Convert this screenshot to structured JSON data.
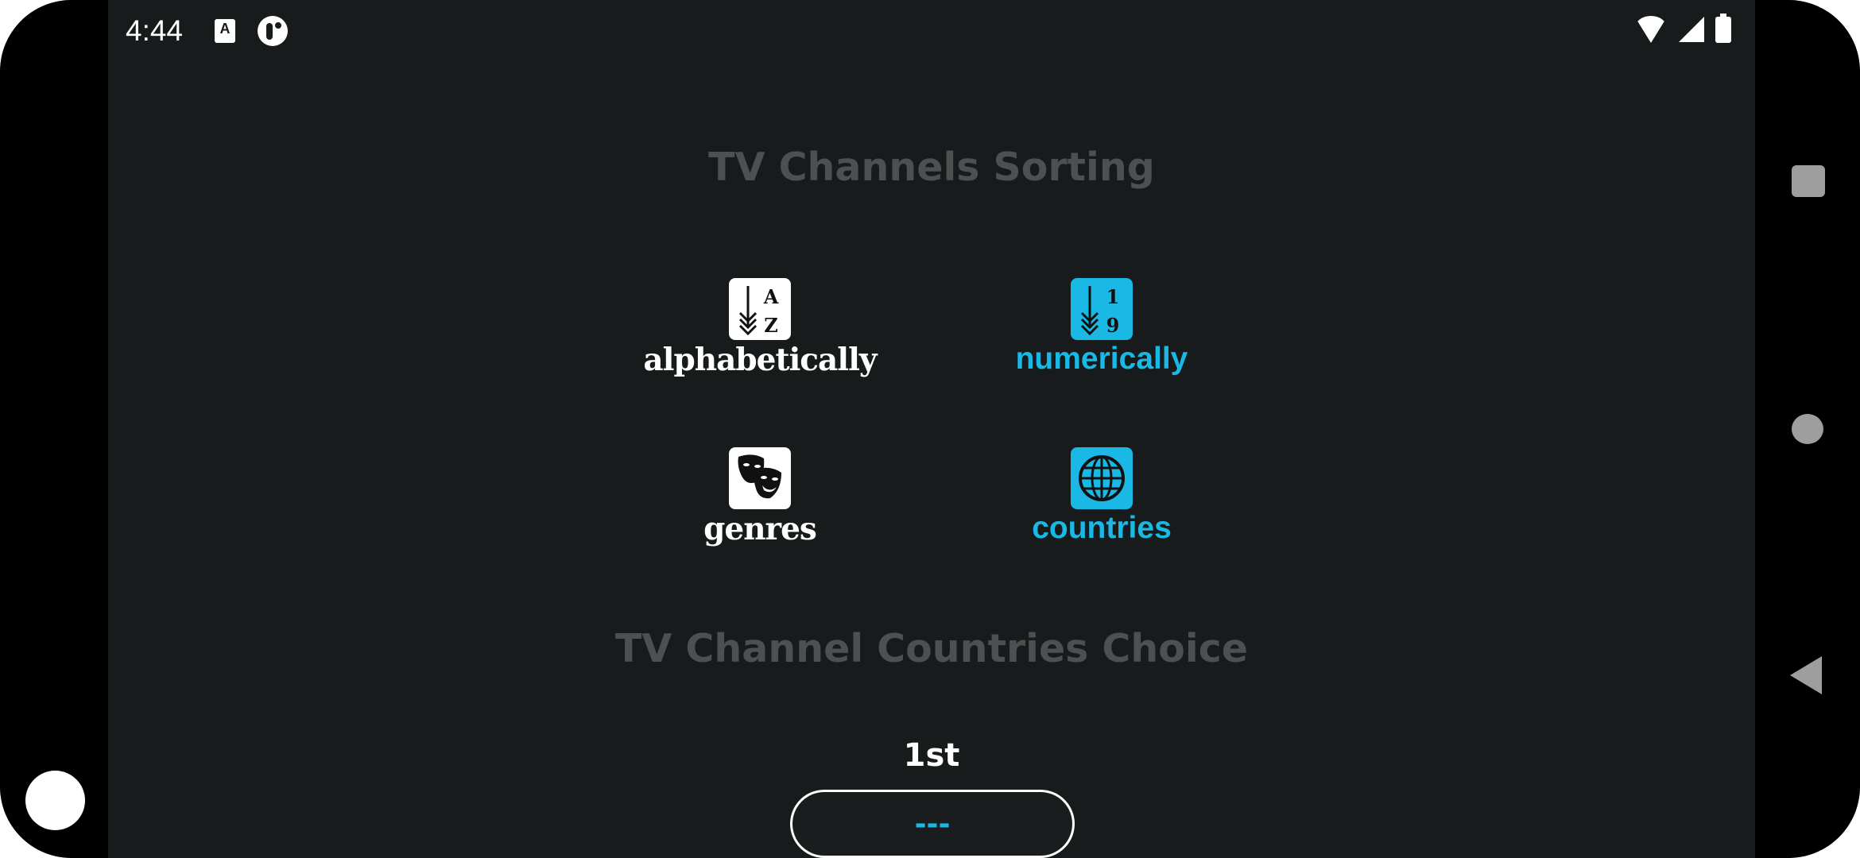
{
  "status_bar": {
    "time": "4:44",
    "notification_icons": [
      "accessibility-a-icon",
      "app-t-icon"
    ],
    "system_icons": [
      "wifi-icon",
      "cell-signal-icon",
      "battery-icon"
    ]
  },
  "nav_bar": {
    "buttons": [
      "recents",
      "home",
      "back"
    ],
    "color": "#9e9e9e"
  },
  "sorting_section": {
    "title": "TV Channels Sorting",
    "options": [
      {
        "label": "alphabetically",
        "icon": "sort-az-icon",
        "glyph_top": "A",
        "glyph_bottom": "Z",
        "selected": false
      },
      {
        "label": "numerically",
        "icon": "sort-19-icon",
        "glyph_top": "1",
        "glyph_bottom": "9",
        "selected": true
      },
      {
        "label": "genres",
        "icon": "theater-masks-icon",
        "selected": false
      },
      {
        "label": "countries",
        "icon": "globe-icon",
        "selected": true
      }
    ]
  },
  "countries_section": {
    "title": "TV Channel Countries Choice",
    "rank_label": "1st",
    "choice_value": "---"
  },
  "colors": {
    "background": "#181b1b",
    "accent": "#1ab8e4",
    "title": "#4a5150",
    "text": "#ffffff"
  }
}
